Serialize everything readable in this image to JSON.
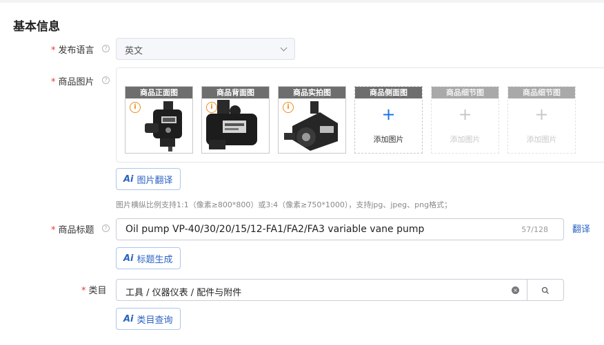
{
  "section": {
    "title": "基本信息"
  },
  "fields": {
    "language": {
      "label": "发布语言",
      "value": "英文"
    },
    "images": {
      "label": "商品图片",
      "slots": [
        {
          "caption": "商品正面图",
          "state": "filled",
          "warning": true
        },
        {
          "caption": "商品背面图",
          "state": "filled",
          "warning": true
        },
        {
          "caption": "商品实拍图",
          "state": "filled",
          "warning": true
        },
        {
          "caption": "商品侧面图",
          "state": "empty",
          "add_label": "添加图片"
        },
        {
          "caption": "商品细节图",
          "state": "disabled",
          "add_label": "添加图片"
        },
        {
          "caption": "商品细节图",
          "state": "disabled",
          "add_label": "添加图片"
        }
      ],
      "ai_button": {
        "icon_text": "Ai",
        "label": "图片翻译"
      },
      "hint": "图片横纵比例支持1:1（像素≥800*800）或3:4（像素≥750*1000），支持jpg、jpeg、png格式；"
    },
    "title": {
      "label": "商品标题",
      "value": "Oil pump VP-40/30/20/15/12-FA1/FA2/FA3 variable vane pump",
      "counter": "57/128",
      "translate_link": "翻译",
      "ai_button": {
        "icon_text": "Ai",
        "label": "标题生成"
      }
    },
    "category": {
      "label": "类目",
      "value": "工具 / 仪器仪表 / 配件与附件",
      "ai_button": {
        "icon_text": "Ai",
        "label": "类目查询"
      }
    }
  },
  "icons": {
    "help": "question-circle-icon",
    "warning": "info-circle-icon",
    "chevron": "chevron-down-icon",
    "clear": "clear-icon",
    "search": "search-icon"
  },
  "colors": {
    "required": "#e53935",
    "accent": "#2b63c4",
    "warning": "#f08a1c"
  }
}
